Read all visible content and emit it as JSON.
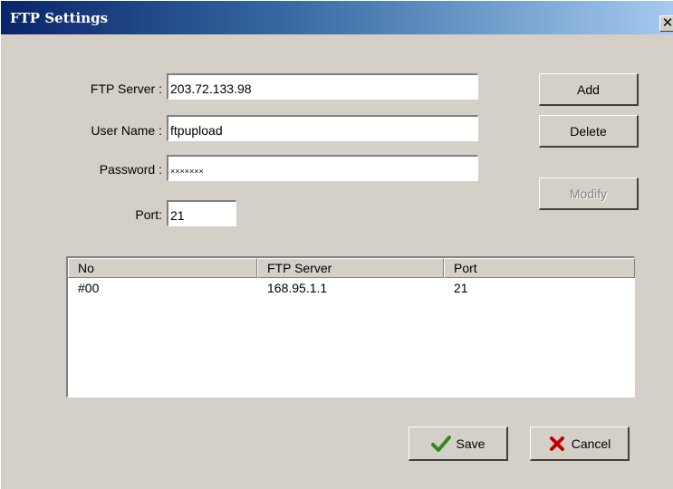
{
  "window": {
    "title": "FTP Settings",
    "close_glyph": "✕"
  },
  "form": {
    "server_label": "FTP Server :",
    "server_value": "203.72.133.98",
    "username_label": "User Name :",
    "username_value": "ftpupload",
    "password_label": "Password :",
    "password_value": "×××××××",
    "port_label": "Port:",
    "port_value": "21"
  },
  "buttons": {
    "add": "Add",
    "delete": "Delete",
    "modify": "Modify",
    "save": "Save",
    "cancel": "Cancel"
  },
  "list": {
    "columns": [
      "No",
      "FTP Server",
      "Port"
    ],
    "rows": [
      {
        "no": "#00",
        "server": "168.95.1.1",
        "port": "21"
      }
    ]
  },
  "icons": {
    "save": "check-icon",
    "cancel": "x-mark-icon",
    "save_color": "#2e8b1e",
    "cancel_color": "#c00000"
  }
}
